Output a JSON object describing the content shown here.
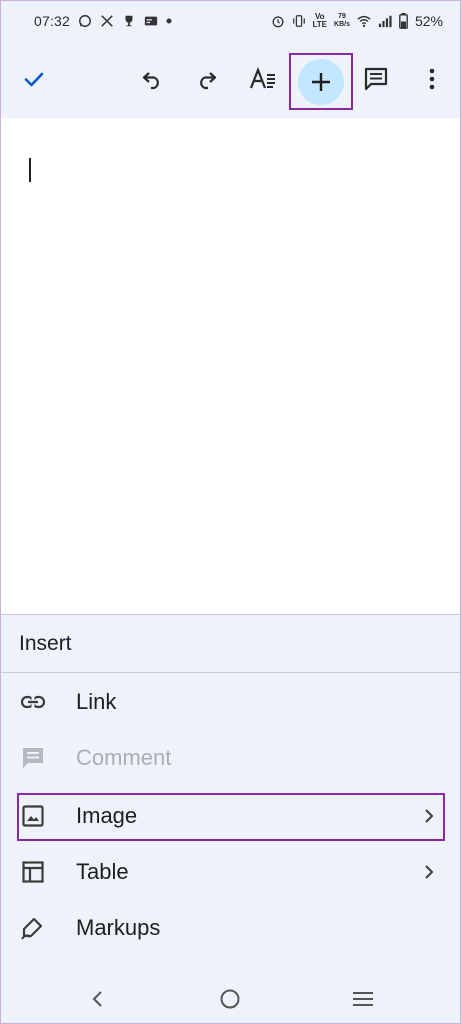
{
  "status": {
    "time": "07:32",
    "netspeed_value": "79",
    "netspeed_unit": "KB/s",
    "network_type": "LTE",
    "battery": "52%"
  },
  "toolbar": {
    "confirm_icon": "check-icon",
    "undo_icon": "undo-icon",
    "redo_icon": "redo-icon",
    "format_icon": "text-format-icon",
    "insert_icon": "plus-icon",
    "comment_icon": "comment-icon",
    "more_icon": "more-vert-icon"
  },
  "insert_panel": {
    "title": "Insert",
    "items": [
      {
        "label": "Link",
        "icon": "link-icon",
        "disabled": false,
        "has_submenu": false
      },
      {
        "label": "Comment",
        "icon": "comment-icon",
        "disabled": true,
        "has_submenu": false
      },
      {
        "label": "Image",
        "icon": "image-icon",
        "disabled": false,
        "has_submenu": true,
        "highlighted": true
      },
      {
        "label": "Table",
        "icon": "table-icon",
        "disabled": false,
        "has_submenu": true
      },
      {
        "label": "Markups",
        "icon": "markup-pen-icon",
        "disabled": false,
        "has_submenu": false
      }
    ]
  },
  "colors": {
    "toolbar_bg": "#eef2fa",
    "accent_check": "#0b57d0",
    "insert_button_bg": "#c2e7ff",
    "highlight_border": "#8a2aa0",
    "disabled_text": "#a9aeb5"
  },
  "nav": {
    "back_icon": "back-chevron-icon",
    "home_icon": "home-circle-icon",
    "recents_icon": "menu-lines-icon"
  }
}
